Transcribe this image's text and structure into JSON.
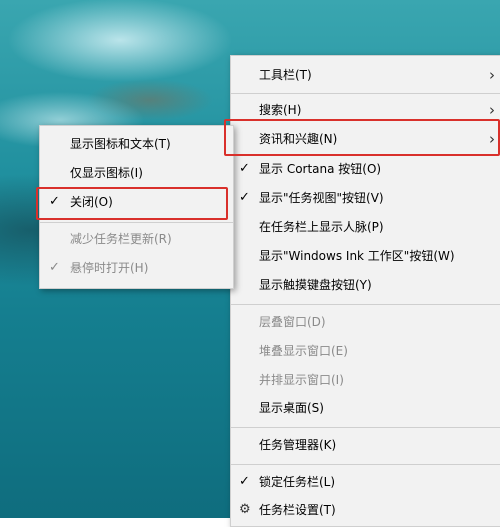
{
  "main_menu": {
    "items": [
      {
        "label": "工具栏(T)"
      },
      {
        "label": "搜索(H)"
      },
      {
        "label": "资讯和兴趣(N)"
      },
      {
        "label": "显示 Cortana 按钮(O)"
      },
      {
        "label": "显示\"任务视图\"按钮(V)"
      },
      {
        "label": "在任务栏上显示人脉(P)"
      },
      {
        "label": "显示\"Windows Ink 工作区\"按钮(W)"
      },
      {
        "label": "显示触摸键盘按钮(Y)"
      },
      {
        "label": "层叠窗口(D)"
      },
      {
        "label": "堆叠显示窗口(E)"
      },
      {
        "label": "并排显示窗口(I)"
      },
      {
        "label": "显示桌面(S)"
      },
      {
        "label": "任务管理器(K)"
      },
      {
        "label": "锁定任务栏(L)"
      },
      {
        "label": "任务栏设置(T)"
      }
    ],
    "check_glyph": "✓",
    "submenu_arrow": "›",
    "settings_icon": "gear-icon"
  },
  "sub_menu": {
    "items": [
      {
        "label": "显示图标和文本(T)"
      },
      {
        "label": "仅显示图标(I)"
      },
      {
        "label": "关闭(O)"
      },
      {
        "label": "减少任务栏更新(R)"
      },
      {
        "label": "悬停时打开(H)"
      }
    ]
  },
  "colors": {
    "menu_background": "#f2f2f2",
    "highlight_border": "#d9302b",
    "disabled_text": "#8a8a8a"
  }
}
